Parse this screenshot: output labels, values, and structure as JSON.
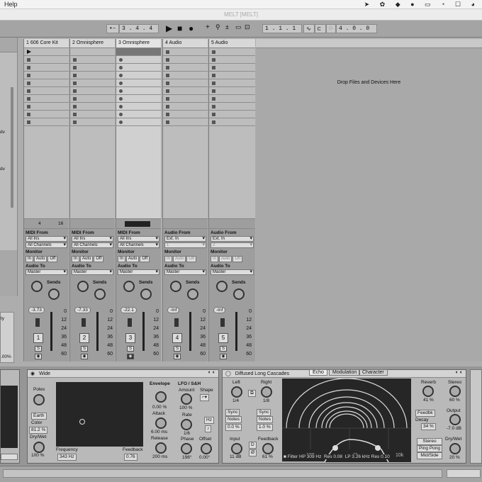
{
  "menubar": {
    "help": "Help",
    "icons": "➤ ✿ ◆ ● ▭ ◔ ☐ ◕"
  },
  "window": {
    "title": "MELT  [MELT]"
  },
  "transport": {
    "signature": "3 . 4 . 4",
    "position": "1 . 1 . 1",
    "end": "4 . 0 . 0"
  },
  "tracks": [
    {
      "name": "1 606 Core Kit",
      "input": "All Ins",
      "channel": "All Channels",
      "output": "Master",
      "volume": "-3.73",
      "number": "1",
      "midi": "MIDI From",
      "clip_top": "4",
      "clip_bot": "16"
    },
    {
      "name": "2 Omnisphere",
      "input": "All Ins",
      "channel": "All Channels",
      "output": "Master",
      "volume": "-7.33",
      "number": "2",
      "midi": "MIDI From"
    },
    {
      "name": "3 Omnisphere",
      "input": "All Ins",
      "channel": "All Channels",
      "output": "Master",
      "volume": "-22.1",
      "number": "3",
      "midi": "MIDI From"
    },
    {
      "name": "4 Audio",
      "input": "Ext. In",
      "channel": "1",
      "output": "Master",
      "volume": "-Inf",
      "number": "4",
      "midi": "Audio From"
    },
    {
      "name": "5 Audio",
      "input": "Ext. In",
      "channel": "2",
      "output": "Master",
      "volume": "-Inf",
      "number": "5",
      "midi": "Audio From"
    }
  ],
  "labels": {
    "monitor": "Monitor",
    "in": "In",
    "auto": "Auto",
    "off": "Off",
    "audio_to": "Audio To",
    "sends": "Sends",
    "a": "A",
    "b": "B",
    "s": "S",
    "scale": [
      "0",
      "12",
      "24",
      "36",
      "48",
      "60"
    ],
    "drop": "Drop Files and Devices Here"
  },
  "left": {
    "dv1": "dv",
    "dv2": "dv",
    "ty": "ty",
    "pct": ".00%"
  },
  "wide": {
    "title": "Wide",
    "poles": "Poles",
    "earth": "Earth",
    "color": "Color",
    "color_val": "81.2 %",
    "drywet": "Dry/Wet",
    "drywet_val": "100 %",
    "frequency": "Frequency",
    "freq_val": "343 Hz",
    "feedback": "Feedback",
    "feedback_val": "0.76",
    "envelope": "Envelope",
    "env_val": "0.00 %",
    "attack": "Attack",
    "attack_val": "6.00 ms",
    "release": "Release",
    "release_val": "200 ms",
    "lfo": "LFO / S&H",
    "amount": "Amount",
    "amount_val": "100 %",
    "shape": "Shape",
    "rate": "Rate",
    "rate_val": "1/6",
    "hz": "Hz",
    "phase": "Phase",
    "phase_val": "196°",
    "offset": "Offset",
    "offset_val": "0.00°"
  },
  "echo": {
    "title": "Diffused Long Cascades",
    "tabs": [
      "Echo",
      "Modulation",
      "Character"
    ],
    "left": "Left",
    "left_val": "1/4",
    "right": "Right",
    "right_val": "1/8",
    "sync": "Sync",
    "notes": "Notes",
    "left_off": "0.0 %",
    "right_off": "1.0 %",
    "input": "Input",
    "input_val": "11 dB",
    "d": "D",
    "phi": "Ø",
    "feedback": "Feedback",
    "feedback_val": "61 %",
    "axis": [
      "100",
      "1k",
      "10k"
    ],
    "filter": "Filter",
    "hp": "HP",
    "hp_val": "309 Hz",
    "res": "Res",
    "res1": "0.08",
    "lp": "LP",
    "lp_val": "3.26 kHz",
    "res2": "0.10",
    "reverb": "Reverb",
    "reverb_val": "41 %",
    "stereo": "Stereo",
    "stereo_val": "60 %",
    "feedbk": "Feedbk",
    "decay": "Decay",
    "decay_val": "34 %",
    "output": "Output",
    "output_val": "-7.0 dB",
    "stereo_btn": "Stereo",
    "pingpong": "Ping Pong",
    "midside": "Mid/Side",
    "drywet": "Dry/Wet",
    "drywet_val": "20 %"
  },
  "colors": {
    "bg": "#adadad",
    "dark": "#262626"
  }
}
